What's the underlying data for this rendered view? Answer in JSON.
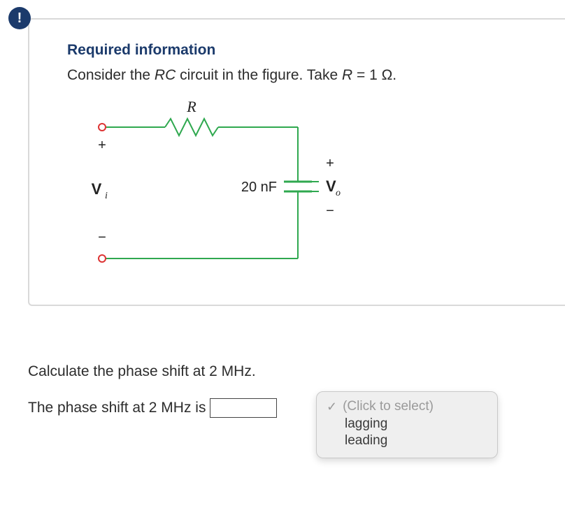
{
  "badge": "!",
  "card": {
    "title": "Required information",
    "prompt_prefix": "Consider the ",
    "prompt_rc": "RC",
    "prompt_mid": " circuit in the figure. Take ",
    "prompt_Rvar": "R",
    "prompt_eq": " = 1 Ω."
  },
  "circuit": {
    "R_label": "R",
    "cap_value": "20 nF",
    "Vi_plus": "+",
    "Vi_label_V": "V",
    "Vi_label_sub": "i",
    "Vi_minus": "−",
    "Vo_plus": "+",
    "Vo_label_V": "V",
    "Vo_label_sub": "o",
    "Vo_minus": "−"
  },
  "question": {
    "line": "Calculate the phase shift at 2 MHz.",
    "answer_prefix": "The phase shift at 2 MHz is ",
    "input_value": ""
  },
  "dropdown": {
    "placeholder": "(Click to select)",
    "options": [
      "lagging",
      "leading"
    ]
  }
}
